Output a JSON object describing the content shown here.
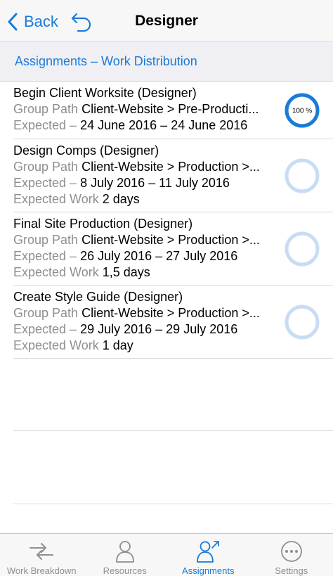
{
  "nav": {
    "back_label": "Back",
    "title": "Designer"
  },
  "breadcrumb": "Assignments – Work Distribution",
  "assignments": [
    {
      "title": "Begin Client Worksite (Designer)",
      "group_label": "Group Path",
      "group_value": "Client-Website > Pre-Producti...",
      "expected_label": "Expected –",
      "expected_value": "24 June 2016 – 24 June 2016",
      "work_label": "",
      "work_value": "",
      "progress": 100,
      "progress_text": "100 %"
    },
    {
      "title": "Design Comps (Designer)",
      "group_label": "Group Path",
      "group_value": "Client-Website > Production >...",
      "expected_label": "Expected –",
      "expected_value": "8 July 2016 – 11 July 2016",
      "work_label": "Expected Work",
      "work_value": "2 days",
      "progress": 0,
      "progress_text": ""
    },
    {
      "title": "Final Site Production (Designer)",
      "group_label": "Group Path",
      "group_value": "Client-Website > Production >...",
      "expected_label": "Expected –",
      "expected_value": "26 July 2016 – 27 July 2016",
      "work_label": "Expected Work",
      "work_value": "1,5 days",
      "progress": 0,
      "progress_text": ""
    },
    {
      "title": "Create Style Guide (Designer)",
      "group_label": "Group Path",
      "group_value": "Client-Website > Production >...",
      "expected_label": "Expected –",
      "expected_value": "29 July 2016 – 29 July 2016",
      "work_label": "Expected Work",
      "work_value": "1 day",
      "progress": 0,
      "progress_text": ""
    }
  ],
  "tabs": [
    {
      "label": "Work Breakdown",
      "icon": "work-breakdown-icon",
      "active": false
    },
    {
      "label": "Resources",
      "icon": "person-icon",
      "active": false
    },
    {
      "label": "Assignments",
      "icon": "assignments-icon",
      "active": true
    },
    {
      "label": "Settings",
      "icon": "ellipsis-icon",
      "active": false
    }
  ],
  "colors": {
    "accent": "#1a7bd9",
    "ring_done": "#1a7bd9",
    "ring_empty": "#c9dcf5",
    "secondary_text": "#8e8e93"
  }
}
